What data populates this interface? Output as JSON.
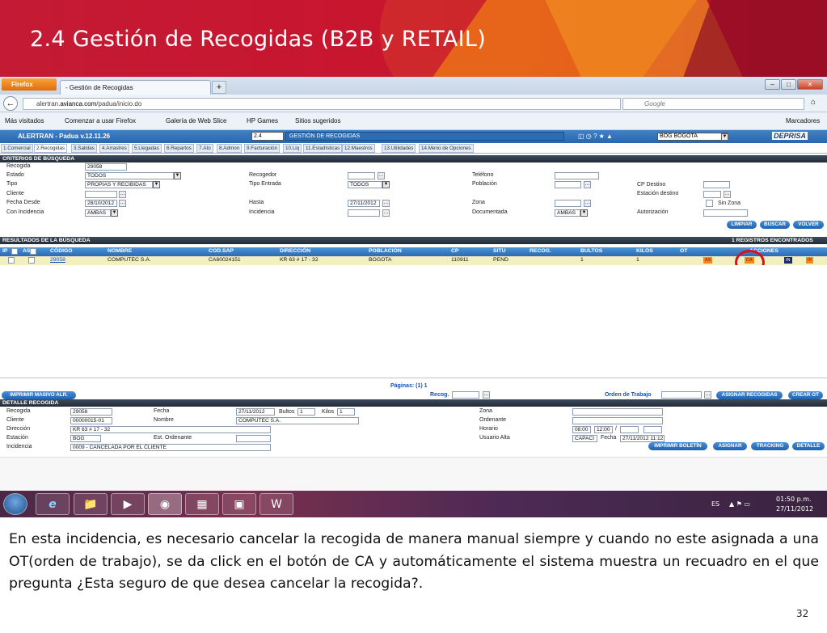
{
  "slide": {
    "title": "2.4 Gestión de Recogidas (B2B y RETAIL)",
    "body": "En esta incidencia, es necesario cancelar la recogida de manera manual siempre y cuando no este asignada a una OT(orden de trabajo), se da click en el botón de CA y automáticamente el sistema muestra un recuadro en el que pregunta ¿Esta seguro de que desea cancelar la recogida?.",
    "page_number": "32"
  },
  "browser": {
    "menu_button": "Firefox",
    "tab_title": "- Gestión de Recogidas",
    "new_tab": "+",
    "url_prefix": "alertran.",
    "url_domain": "avianca.com",
    "url_path": "/padua/inicio.do",
    "search_placeholder": "Google",
    "bookmarks": [
      "Más visitados",
      "Comenzar a usar Firefox",
      "Galería de Web Slice",
      "HP Games",
      "Sitios sugeridos"
    ],
    "bookmarks_menu": "Marcadores",
    "window_controls": [
      "–",
      "□",
      "✕"
    ]
  },
  "app": {
    "title": "ALERTRAN - Padua  v.12.11.26",
    "module_code": "2.4",
    "module_name": "GESTIÓN DE RECOGIDAS",
    "city": "BOG BOGOTA",
    "brand": "DEPRISA",
    "menu": [
      "1.Comercial",
      "2.Recogidas",
      "3.Salidas",
      "4.Arrastres",
      "5.Llegadas",
      "6.Repartos",
      "7.Ato",
      "8.Admon",
      "9.Facturación",
      "10.Liq",
      "11.Estadísticas",
      "12.Maestros",
      "13.Utilidades",
      "14.Menú de Opciones"
    ]
  },
  "criteria": {
    "section_title": "CRITERIOS DE BÚSQUEDA",
    "recogida_label": "Recogida",
    "recogida_value": "29058",
    "estado_label": "Estado",
    "estado_value": "TODOS",
    "tipo_label": "Tipo",
    "tipo_value": "PROPIAS Y RECIBIDAS",
    "cliente_label": "Cliente",
    "fecha_desde_label": "Fecha Desde",
    "fecha_desde_value": "28/10/2012",
    "con_incidencia_label": "Con Incidencia",
    "con_incidencia_value": "AMBAS",
    "recogedor_label": "Recogedor",
    "tipo_entrada_label": "Tipo Entrada",
    "tipo_entrada_value": "TODOS",
    "hasta_label": "Hasta",
    "hasta_value": "27/11/2012",
    "incidencia_label": "Incidencia",
    "telefono_label": "Teléfono",
    "poblacion_label": "Población",
    "zona_label": "Zona",
    "documentada_label": "Documentada",
    "documentada_value": "AMBAS",
    "cp_destino_label": "CP Destino",
    "estacion_destino_label": "Estación destino",
    "sin_zona_label": "Sin Zona",
    "autorizacion_label": "Autorización",
    "btn_limpiar": "LIMPIAR",
    "btn_buscar": "BUSCAR",
    "btn_volver": "VOLVER"
  },
  "results": {
    "section_title": "RESULTADOS DE LA BÚSQUEDA",
    "found": "1 REGISTROS ENCONTRADOS",
    "columns": [
      "IP",
      "AS",
      "CÓDIGO",
      "NOMBRE",
      "COD.SAP",
      "DIRECCIÓN",
      "POBLACIÓN",
      "CP",
      "SITU",
      "RECOG.",
      "BULTOS",
      "KILOS",
      "OT",
      "ACCIONES"
    ],
    "row": {
      "codigo": "29058",
      "nombre": "COMPUTEC S.A.",
      "cod_sap": "CA60024151",
      "direccion": "KR 63 # 17 - 32",
      "poblacion": "BOGOTA",
      "cp": "110911",
      "situ": "PEND",
      "recog": "",
      "bultos": "1",
      "kilos": "1",
      "ot": "",
      "actions": [
        "AS",
        "CA",
        "IN",
        "IP"
      ]
    },
    "pages": "Páginas: (1)   1",
    "recog_label": "Recog.",
    "orden_label": "Orden de Trabajo",
    "btn_imprimir_masivo": "IMPRIMIR MASIVO ALR.",
    "btn_asignar_recogidas": "ASIGNAR RECOGIDAS",
    "btn_crear_ot": "CREAR OT"
  },
  "detail": {
    "section_title": "DETALLE RECOGIDA",
    "recogida_label": "Recogida",
    "recogida_value": "29058",
    "cliente_label": "Cliente",
    "cliente_value": "00000015-01",
    "direccion_label": "Dirección",
    "direccion_value": "KR 63 # 17 - 32",
    "estacion_label": "Estación",
    "estacion_value": "BOG",
    "incidencia_label": "Incidencia",
    "incidencia_value": "0009 - CANCELADA POR EL CLIENTE",
    "fecha_label": "Fecha",
    "fecha_value": "27/11/2012",
    "bultos_label": "Bultos",
    "bultos_value": "1",
    "kilos_label": "Kilos",
    "kilos_value": "1",
    "nombre_label": "Nombre",
    "nombre_value": "COMPUTEC S.A.",
    "est_ordenante_label": "Est. Ordenante",
    "zona_label": "Zona",
    "ordenante_label": "Ordenante",
    "horario_label": "Horario",
    "horario_from": "08:00",
    "horario_to": "12:00",
    "usuario_alta_label": "Usuario Alta",
    "usuario_alta_value": "CAPACI",
    "usuario_fecha_label": "Fecha",
    "usuario_fecha_value": "27/11/2012 11:12",
    "btn_imprimir_boletin": "IMPRIMIR BOLETÍN",
    "btn_asignar": "ASIGNAR",
    "btn_tracking": "TRACKING",
    "btn_detalle": "DETALLE"
  },
  "taskbar": {
    "lang": "ES",
    "time": "01:50 p.m.",
    "date": "27/11/2012"
  }
}
